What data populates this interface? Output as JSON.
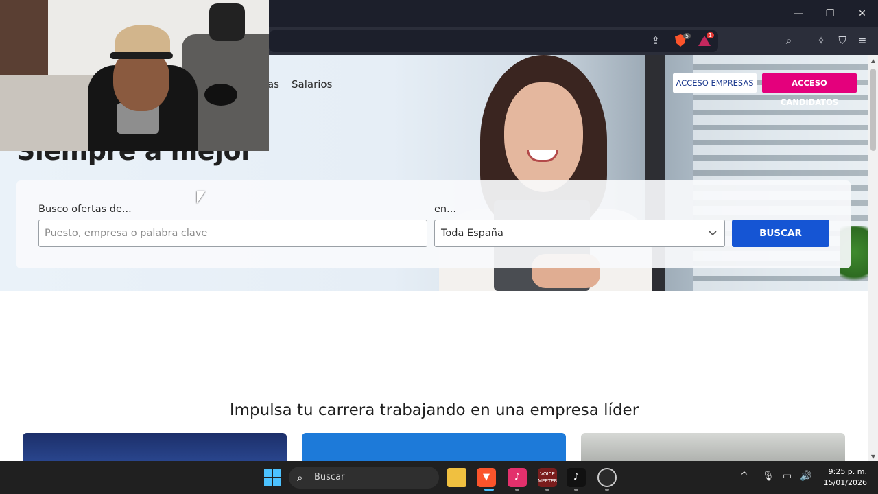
{
  "window": {
    "minimize": "—",
    "restore": "❐",
    "close": "✕"
  },
  "browser": {
    "brave_badge": "5",
    "rewards_badge": "1",
    "share_icon": "share-icon",
    "search_icon": "search-in-page-icon"
  },
  "page": {
    "nav": {
      "partial": "as",
      "salarios": "Salarios"
    },
    "buttons": {
      "empresas": "ACCESO EMPRESAS",
      "candidatos": "ACCESO CANDIDATOS"
    },
    "hero_title": "Siempre a mejor",
    "search": {
      "label_query": "Busco ofertas de...",
      "placeholder": "Puesto, empresa o palabra clave",
      "label_location": "en...",
      "location_value": "Toda España",
      "submit": "BUSCAR"
    },
    "section_title": "Impulsa tu carrera trabajando en una empresa líder"
  },
  "colors": {
    "candidatos_bg": "#e4007c",
    "buscar_bg": "#1555d4",
    "empresas_text": "#1d3b8f"
  },
  "taskbar": {
    "search_label": "Buscar",
    "voice_label_1": "VOICE",
    "voice_label_2": "MEETER",
    "time": "9:25 p. m.",
    "date": "15/01/2026"
  }
}
